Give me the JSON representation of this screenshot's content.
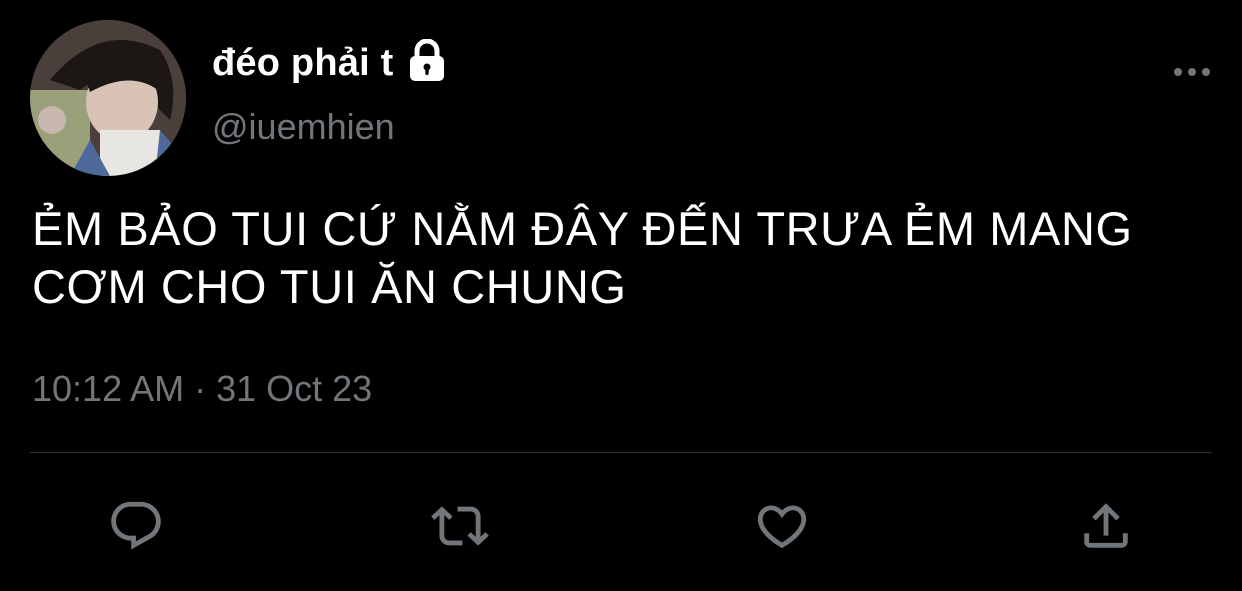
{
  "author": {
    "display_name": "đéo phải t",
    "handle": "@iuemhien",
    "protected": true,
    "avatar_icon": "user-avatar-photo"
  },
  "tweet": {
    "text": "ẺM BẢO TUI CỨ NẰM ĐÂY ĐẾN TRƯA ẺM MANG CƠM CHO TUI ĂN CHUNG",
    "timestamp": "10:12 AM · 31 Oct 23"
  },
  "actions": [
    {
      "name": "reply",
      "icon": "reply-icon"
    },
    {
      "name": "retweet",
      "icon": "retweet-icon"
    },
    {
      "name": "like",
      "icon": "heart-icon"
    },
    {
      "name": "share",
      "icon": "share-icon"
    }
  ],
  "colors": {
    "background": "#000000",
    "primary_text": "#ffffff",
    "secondary_text": "#71767b",
    "icon": "#71767b",
    "divider": "#2f3336"
  }
}
